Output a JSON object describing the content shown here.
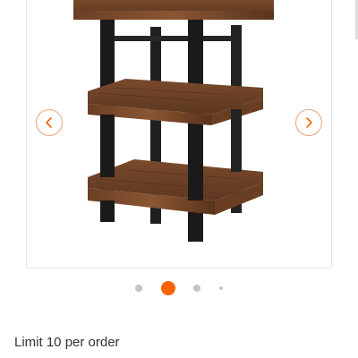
{
  "gallery": {
    "image_alt": "Wood and metal 2-shelf end table",
    "prev_icon": "chevron-left-icon",
    "next_icon": "chevron-right-icon",
    "accent_color": "#f96302",
    "dot_color": "#c4c4c4",
    "nav_border_color": "#e8a57a",
    "active_index": 2,
    "total_indicators": 4
  },
  "purchase": {
    "limit_text": "Limit 10 per order"
  }
}
